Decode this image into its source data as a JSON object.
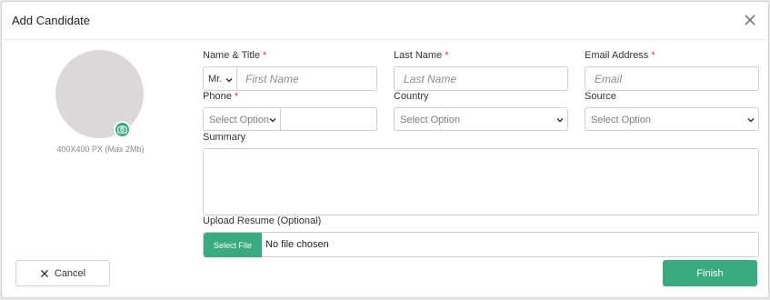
{
  "modal": {
    "title": "Add Candidate"
  },
  "icons": {
    "close": "close-icon",
    "camera": "camera-icon",
    "chevron": "chevron-down-icon",
    "cancel": "x-icon"
  },
  "colors": {
    "accent": "#3aaa7f",
    "required": "#e53935"
  },
  "avatar": {
    "hint": "400X400 PX (Max 2Mb)"
  },
  "fields": {
    "name_title": {
      "label": "Name & Title",
      "title_value": "Mr.",
      "placeholder": "First Name"
    },
    "last_name": {
      "label": "Last Name",
      "placeholder": "Last Name"
    },
    "email": {
      "label": "Email Address",
      "placeholder": "Email"
    },
    "phone": {
      "label": "Phone",
      "select_placeholder": "Select Option"
    },
    "country": {
      "label": "Country",
      "select_placeholder": "Select Option"
    },
    "source": {
      "label": "Source",
      "select_placeholder": "Select Option"
    },
    "summary": {
      "label": "Summary"
    },
    "resume": {
      "label": "Upload Resume (Optional)",
      "button": "Select File",
      "file_text": "No file chosen"
    }
  },
  "required_marker": "*",
  "actions": {
    "cancel": "Cancel",
    "finish": "Finish"
  }
}
